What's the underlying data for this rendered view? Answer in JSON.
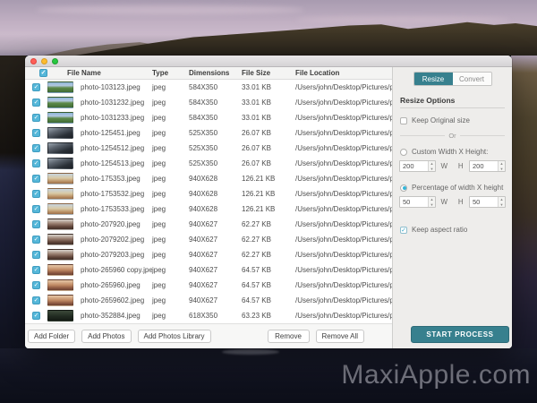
{
  "desktop": {
    "watermark": "MaxiApple.com"
  },
  "window": {
    "titlebar": {
      "buttons": [
        "close",
        "minimize",
        "zoom"
      ]
    },
    "table": {
      "select_all_checked": true,
      "columns": [
        "File Name",
        "Type",
        "Dimensions",
        "File Size",
        "File Location"
      ],
      "rows": [
        {
          "name": "photo-103123.jpeg",
          "type": "jpeg",
          "dimensions": "584X350",
          "size": "33.01 KB",
          "location": "/Users/john/Desktop/Pictures/p...",
          "thumb": "green-mountain",
          "checked": true
        },
        {
          "name": "photo-1031232.jpeg",
          "type": "jpeg",
          "dimensions": "584X350",
          "size": "33.01 KB",
          "location": "/Users/john/Desktop/Pictures/p...",
          "thumb": "green-mountain",
          "checked": true
        },
        {
          "name": "photo-1031233.jpeg",
          "type": "jpeg",
          "dimensions": "584X350",
          "size": "33.01 KB",
          "location": "/Users/john/Desktop/Pictures/p...",
          "thumb": "green-mountain",
          "checked": true
        },
        {
          "name": "photo-125451.jpeg",
          "type": "jpeg",
          "dimensions": "525X350",
          "size": "26.07 KB",
          "location": "/Users/john/Desktop/Pictures/p...",
          "thumb": "dark-peaks",
          "checked": true
        },
        {
          "name": "photo-1254512.jpeg",
          "type": "jpeg",
          "dimensions": "525X350",
          "size": "26.07 KB",
          "location": "/Users/john/Desktop/Pictures/p...",
          "thumb": "dark-peaks",
          "checked": true
        },
        {
          "name": "photo-1254513.jpeg",
          "type": "jpeg",
          "dimensions": "525X350",
          "size": "26.07 KB",
          "location": "/Users/john/Desktop/Pictures/p...",
          "thumb": "dark-peaks",
          "checked": true
        },
        {
          "name": "photo-175353.jpeg",
          "type": "jpeg",
          "dimensions": "940X628",
          "size": "126.21 KB",
          "location": "/Users/john/Desktop/Pictures/p...",
          "thumb": "beach",
          "checked": true
        },
        {
          "name": "photo-1753532.jpeg",
          "type": "jpeg",
          "dimensions": "940X628",
          "size": "126.21 KB",
          "location": "/Users/john/Desktop/Pictures/p...",
          "thumb": "beach",
          "checked": true
        },
        {
          "name": "photo-1753533.jpeg",
          "type": "jpeg",
          "dimensions": "940X628",
          "size": "126.21 KB",
          "location": "/Users/john/Desktop/Pictures/p...",
          "thumb": "beach",
          "checked": true
        },
        {
          "name": "photo-207920.jpeg",
          "type": "jpeg",
          "dimensions": "940X627",
          "size": "62.27 KB",
          "location": "/Users/john/Desktop/Pictures/p...",
          "thumb": "people-dark",
          "checked": true
        },
        {
          "name": "photo-2079202.jpeg",
          "type": "jpeg",
          "dimensions": "940X627",
          "size": "62.27 KB",
          "location": "/Users/john/Desktop/Pictures/p...",
          "thumb": "people-dark",
          "checked": true
        },
        {
          "name": "photo-2079203.jpeg",
          "type": "jpeg",
          "dimensions": "940X627",
          "size": "62.27 KB",
          "location": "/Users/john/Desktop/Pictures/p...",
          "thumb": "people-dark",
          "checked": true
        },
        {
          "name": "photo-265960 copy.jpeg",
          "type": "jpeg",
          "dimensions": "940X627",
          "size": "64.57 KB",
          "location": "/Users/john/Desktop/Pictures/p...",
          "thumb": "portrait",
          "checked": true
        },
        {
          "name": "photo-265960.jpeg",
          "type": "jpeg",
          "dimensions": "940X627",
          "size": "64.57 KB",
          "location": "/Users/john/Desktop/Pictures/p...",
          "thumb": "portrait",
          "checked": true
        },
        {
          "name": "photo-2659602.jpeg",
          "type": "jpeg",
          "dimensions": "940X627",
          "size": "64.57 KB",
          "location": "/Users/john/Desktop/Pictures/p...",
          "thumb": "portrait",
          "checked": true
        },
        {
          "name": "photo-352884.jpeg",
          "type": "jpeg",
          "dimensions": "618X350",
          "size": "63.23 KB",
          "location": "/Users/john/Desktop/Pictures/p...",
          "thumb": "dark-green",
          "checked": true
        }
      ]
    },
    "footer": {
      "add_folder": "Add Folder",
      "add_photos": "Add Photos",
      "add_photos_library": "Add Photos Library",
      "remove": "Remove",
      "remove_all": "Remove All"
    },
    "panel": {
      "tabs": [
        {
          "label": "Resize",
          "active": true
        },
        {
          "label": "Convert",
          "active": false
        }
      ],
      "section_title": "Resize Options",
      "keep_original": {
        "label": "Keep Original size",
        "checked": false
      },
      "or_label": "Or",
      "custom_size": {
        "label": "Custom Width X Height:",
        "selected": false,
        "width": "200",
        "height": "200"
      },
      "percentage_size": {
        "label": "Percentage of width X height",
        "selected": true,
        "width": "50",
        "height": "50"
      },
      "w_label": "W",
      "h_label": "H",
      "keep_aspect": {
        "label": "Keep aspect ratio",
        "checked": true
      },
      "start_button": "START PROCESS",
      "accent_color": "#37808e",
      "checkbox_color": "#55b7d9"
    }
  }
}
